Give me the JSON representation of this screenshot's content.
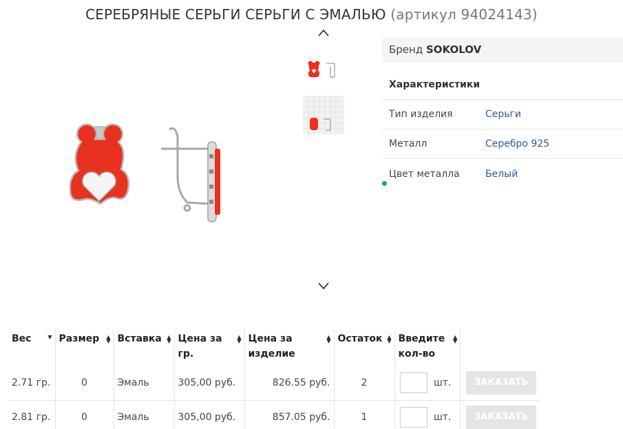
{
  "title": {
    "name": "СЕРЕБРЯНЫЕ СЕРЬГИ СЕРЬГИ С ЭМАЛЬЮ",
    "sku": "(артикул 94024143)"
  },
  "gallery": {
    "up_icon": "chevron-up-icon",
    "down_icon": "chevron-down-icon"
  },
  "specs": {
    "brand_label": "Бренд",
    "brand_value": "SOKOLOV",
    "heading": "Характеристики",
    "rows": [
      {
        "key": "Тип изделия",
        "value": "Серьги"
      },
      {
        "key": "Металл",
        "value": "Серебро 925"
      },
      {
        "key": "Цвет металла",
        "value": "Белый"
      }
    ]
  },
  "table": {
    "headers": [
      "Вес",
      "Размер",
      "Вставка",
      "Цена за гр.",
      "Цена за изделие",
      "Остаток",
      "Введите кол-во"
    ],
    "unit_label": "шт.",
    "order_label": "ЗАКАЗАТЬ",
    "rows": [
      {
        "weight": "2.71 гр.",
        "size": "0",
        "insert": "Эмаль",
        "price_gram": "305,00 руб.",
        "price_item": "826.55 руб.",
        "stock": "2"
      },
      {
        "weight": "2.81 гр.",
        "size": "0",
        "insert": "Эмаль",
        "price_gram": "305,00 руб.",
        "price_item": "857.05 руб.",
        "stock": "1"
      }
    ]
  },
  "colors": {
    "accent_link": "#2a5a9a",
    "enamel": "#e8321f",
    "button_disabled": "#e5e5e5",
    "status_dot": "#1aa36f"
  }
}
